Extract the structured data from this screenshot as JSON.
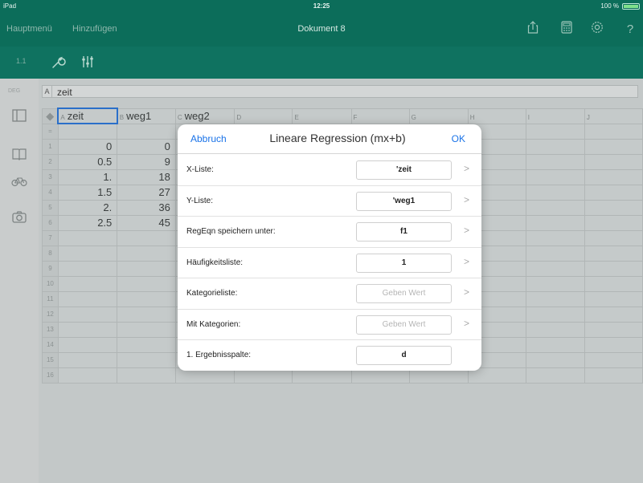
{
  "status_bar": {
    "device": "iPad",
    "time": "12:25",
    "battery": "100 %"
  },
  "title_bar": {
    "menu": "Hauptmenü",
    "add": "Hinzufügen",
    "document_title": "Dokument 8"
  },
  "toolbar": {
    "page": "1.1"
  },
  "sidebar": {
    "label": "DEG"
  },
  "spreadsheet": {
    "cell_ref_column": "A",
    "cell_ref_value": "zeit",
    "columns": [
      {
        "letter": "A",
        "name": "zeit"
      },
      {
        "letter": "B",
        "name": "weg1"
      },
      {
        "letter": "C",
        "name": "weg2"
      },
      {
        "letter": "D",
        "name": ""
      },
      {
        "letter": "E",
        "name": ""
      },
      {
        "letter": "F",
        "name": ""
      },
      {
        "letter": "G",
        "name": ""
      },
      {
        "letter": "H",
        "name": ""
      },
      {
        "letter": "I",
        "name": ""
      },
      {
        "letter": "J",
        "name": ""
      }
    ],
    "formula_row_label": "=",
    "rows": [
      {
        "n": "1",
        "a": "0",
        "b": "0"
      },
      {
        "n": "2",
        "a": "0.5",
        "b": "9"
      },
      {
        "n": "3",
        "a": "1.",
        "b": "18"
      },
      {
        "n": "4",
        "a": "1.5",
        "b": "27"
      },
      {
        "n": "5",
        "a": "2.",
        "b": "36"
      },
      {
        "n": "6",
        "a": "2.5",
        "b": "45"
      },
      {
        "n": "7",
        "a": "",
        "b": ""
      },
      {
        "n": "8",
        "a": "",
        "b": ""
      },
      {
        "n": "9",
        "a": "",
        "b": ""
      },
      {
        "n": "10",
        "a": "",
        "b": ""
      },
      {
        "n": "11",
        "a": "",
        "b": ""
      },
      {
        "n": "12",
        "a": "",
        "b": ""
      },
      {
        "n": "13",
        "a": "",
        "b": ""
      },
      {
        "n": "14",
        "a": "",
        "b": ""
      },
      {
        "n": "15",
        "a": "",
        "b": ""
      },
      {
        "n": "16",
        "a": "",
        "b": ""
      }
    ]
  },
  "dialog": {
    "cancel": "Abbruch",
    "title": "Lineare Regression (mx+b)",
    "ok": "OK",
    "rows": [
      {
        "label": "X-Liste:",
        "value": "'zeit",
        "placeholder": false,
        "chevron": true
      },
      {
        "label": "Y-Liste:",
        "value": "'weg1",
        "placeholder": false,
        "chevron": true
      },
      {
        "label": "RegEqn speichern unter:",
        "value": "f1",
        "placeholder": false,
        "chevron": true
      },
      {
        "label": "Häufigkeitsliste:",
        "value": "1",
        "placeholder": false,
        "chevron": true
      },
      {
        "label": "Kategorieliste:",
        "value": "Geben Wert",
        "placeholder": true,
        "chevron": true
      },
      {
        "label": "Mit Kategorien:",
        "value": "Geben Wert",
        "placeholder": true,
        "chevron": true
      },
      {
        "label": "1. Ergebnisspalte:",
        "value": "d",
        "placeholder": false,
        "chevron": false
      }
    ]
  },
  "colors": {
    "teal": "#0c6d5a",
    "accent_blue": "#1a73e8",
    "selection_border": "#2a6fc9"
  },
  "icons": [
    "share-icon",
    "calculator-icon",
    "settings-icon",
    "help-icon",
    "wrench-icon",
    "sliders-icon",
    "pages-icon",
    "notebook-icon",
    "bicycle-icon",
    "camera-icon"
  ]
}
